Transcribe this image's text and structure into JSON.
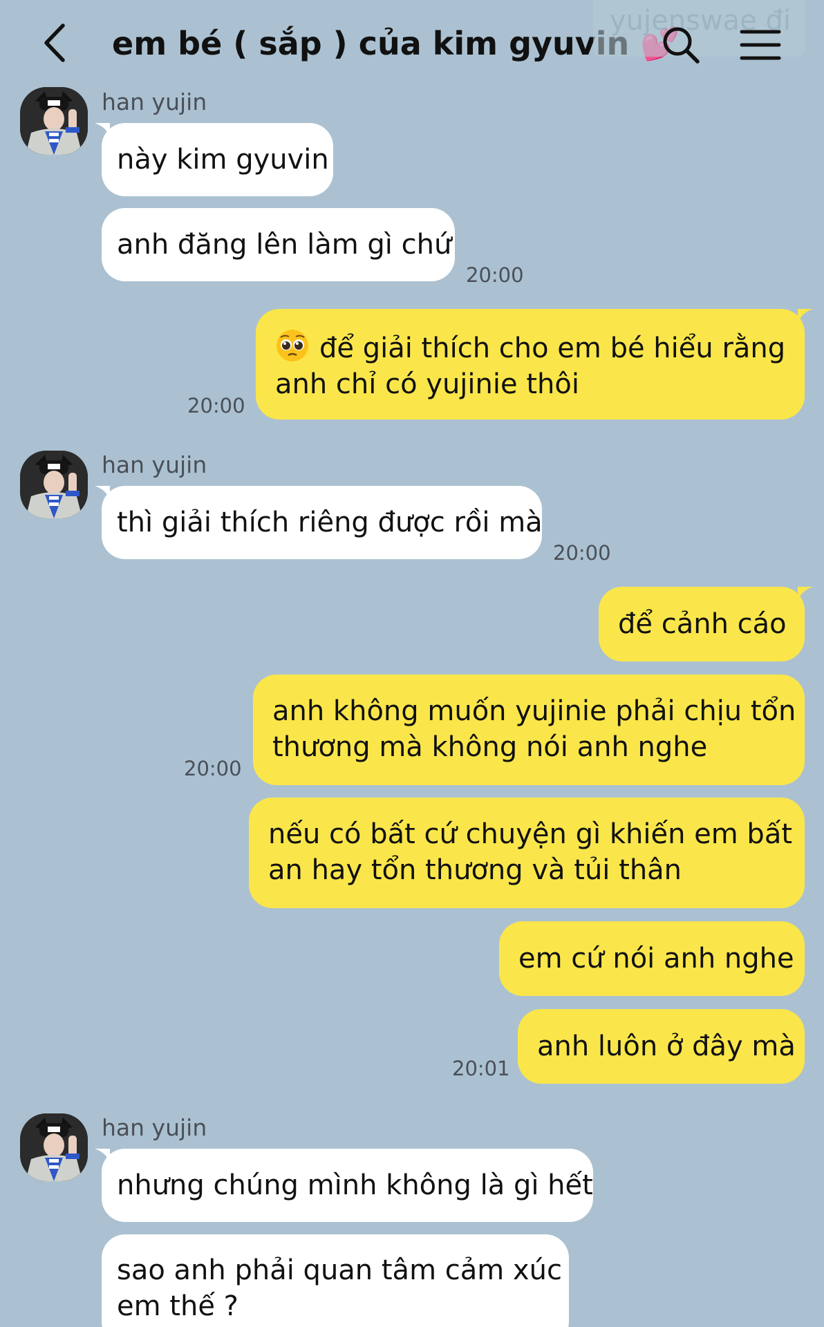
{
  "header": {
    "title": "em bé ( sắp ) của kim gyuvin 💕",
    "watermark": "yujenswae đi",
    "back_icon": "chevron-left-icon",
    "search_icon": "search-icon",
    "menu_icon": "hamburger-menu-icon"
  },
  "colors": {
    "background": "#abc1d1",
    "incoming_bubble": "#ffffff",
    "outgoing_bubble": "#fae64a"
  },
  "messages": [
    {
      "sender": "han yujin",
      "text": "này kim gyuvin"
    },
    {
      "sender": "han yujin",
      "text": "anh đăng lên làm gì chứ",
      "time": "20:00"
    },
    {
      "sender": "me",
      "emoji": "pleading-face",
      "lines": [
        "để giải thích cho em bé hiểu rằng",
        "anh chỉ có yujinie thôi"
      ],
      "time": "20:00"
    },
    {
      "sender": "han yujin",
      "text": "thì giải thích riêng được rồi mà",
      "time": "20:00"
    },
    {
      "sender": "me",
      "text": "để cảnh cáo"
    },
    {
      "sender": "me",
      "lines": [
        "anh không muốn yujinie phải chịu tổn",
        "thương mà không nói anh nghe"
      ],
      "time": "20:00"
    },
    {
      "sender": "me",
      "lines": [
        "nếu có bất cứ chuyện gì khiến em bất",
        "an hay tổn thương và tủi thân"
      ]
    },
    {
      "sender": "me",
      "text": "em cứ nói anh nghe"
    },
    {
      "sender": "me",
      "text": "anh luôn ở đây mà",
      "time": "20:01"
    },
    {
      "sender": "han yujin",
      "text": "nhưng chúng mình không là gì hết"
    },
    {
      "sender": "han yujin",
      "lines": [
        "sao anh phải quan tâm cảm xúc",
        "em thế ?"
      ]
    }
  ]
}
